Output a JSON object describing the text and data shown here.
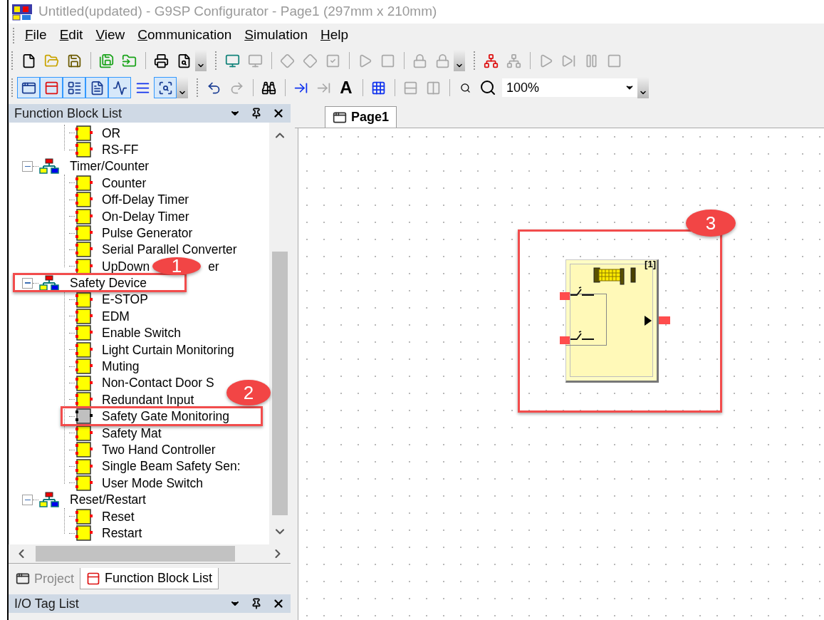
{
  "window": {
    "title": "Untitled(updated) - G9SP Configurator - Page1 (297mm x 210mm)"
  },
  "menu": [
    {
      "label": "File"
    },
    {
      "label": "Edit"
    },
    {
      "label": "View"
    },
    {
      "label": "Communication"
    },
    {
      "label": "Simulation"
    },
    {
      "label": "Help"
    }
  ],
  "toolbars": [
    {
      "sections": [
        {
          "buttons": [
            {
              "kind": "new",
              "disabled": false
            },
            {
              "kind": "open",
              "disabled": false
            },
            {
              "kind": "save",
              "disabled": false
            }
          ]
        },
        {
          "buttons": [
            {
              "kind": "save-as",
              "disabled": false
            },
            {
              "kind": "open-alt",
              "disabled": false
            }
          ]
        },
        {
          "buttons": [
            {
              "kind": "print",
              "disabled": false
            },
            {
              "kind": "preview",
              "disabled": false
            },
            {
              "kind": "overflow"
            }
          ]
        },
        {
          "buttons": [
            {
              "kind": "monitor",
              "disabled": false
            },
            {
              "kind": "monitor",
              "disabled": true
            }
          ]
        },
        {
          "buttons": [
            {
              "kind": "diamond",
              "disabled": true
            },
            {
              "kind": "diamond",
              "disabled": true
            },
            {
              "kind": "check",
              "disabled": true
            }
          ]
        },
        {
          "buttons": [
            {
              "kind": "play",
              "disabled": true
            },
            {
              "kind": "stop",
              "disabled": true
            }
          ]
        },
        {
          "buttons": [
            {
              "kind": "lock",
              "disabled": true
            },
            {
              "kind": "lock",
              "disabled": true
            },
            {
              "kind": "overflow"
            }
          ]
        },
        {
          "buttons": [
            {
              "kind": "network",
              "disabled": false
            },
            {
              "kind": "network",
              "disabled": true
            }
          ]
        },
        {
          "buttons": [
            {
              "kind": "play",
              "disabled": true
            },
            {
              "kind": "step",
              "disabled": true
            },
            {
              "kind": "pause",
              "disabled": true
            },
            {
              "kind": "stop",
              "disabled": true
            }
          ]
        }
      ]
    },
    {
      "sections": [
        {
          "buttons": [
            {
              "kind": "view-project",
              "disabled": false,
              "selected": true
            },
            {
              "kind": "view-blocks",
              "disabled": false,
              "selected": true
            },
            {
              "kind": "view-tags",
              "disabled": false,
              "selected": true
            },
            {
              "kind": "view-output",
              "disabled": false,
              "selected": true
            },
            {
              "kind": "view-monitor",
              "disabled": false,
              "selected": true
            },
            {
              "kind": "view-list",
              "disabled": false,
              "selected": false
            },
            {
              "kind": "view-search",
              "disabled": false,
              "selected": true
            },
            {
              "kind": "overflow"
            }
          ]
        },
        {
          "buttons": [
            {
              "kind": "undo",
              "disabled": false
            },
            {
              "kind": "redo",
              "disabled": true
            }
          ]
        },
        {
          "buttons": [
            {
              "kind": "find",
              "disabled": false
            }
          ]
        },
        {
          "buttons": [
            {
              "kind": "connect",
              "disabled": false
            },
            {
              "kind": "connect",
              "disabled": true
            },
            {
              "kind": "text",
              "label": "A",
              "disabled": false
            }
          ]
        },
        {
          "buttons": [
            {
              "kind": "grid",
              "disabled": false
            }
          ]
        },
        {
          "buttons": [
            {
              "kind": "rows",
              "disabled": true
            },
            {
              "kind": "columns",
              "disabled": true
            }
          ]
        },
        {
          "buttons": [
            {
              "kind": "zoom-out",
              "disabled": false
            },
            {
              "kind": "zoom-in",
              "disabled": false
            },
            {
              "kind": "zoom-combo",
              "value": "100%",
              "disabled": false
            },
            {
              "kind": "overflow"
            }
          ]
        }
      ]
    }
  ],
  "function_block_panel": {
    "title": "Function Block List",
    "tree": [
      {
        "kind": "continued",
        "children": [
          {
            "label": "OR",
            "selected": false
          },
          {
            "label": "RS-FF",
            "selected": false
          }
        ]
      },
      {
        "kind": "group",
        "label": "Timer/Counter",
        "expanded": true,
        "children": [
          {
            "label": "Counter",
            "selected": false
          },
          {
            "label": "Off-Delay Timer",
            "selected": false
          },
          {
            "label": "On-Delay Timer",
            "selected": false
          },
          {
            "label": "Pulse Generator",
            "selected": false
          },
          {
            "label": "Serial Parallel Converter",
            "selected": false
          },
          {
            "label": "UpDown",
            "label_end": "er",
            "selected": false
          }
        ]
      },
      {
        "kind": "group",
        "label": "Safety Device",
        "expanded": true,
        "children": [
          {
            "label": "E-STOP",
            "selected": false
          },
          {
            "label": "EDM",
            "selected": false
          },
          {
            "label": "Enable Switch",
            "selected": false
          },
          {
            "label": "Light Curtain Monitoring",
            "selected": false
          },
          {
            "label": "Muting",
            "selected": false
          },
          {
            "label": "Non-Contact Door S",
            "selected": false
          },
          {
            "label": "Redundant Input",
            "selected": false
          },
          {
            "label": "Safety Gate Monitoring",
            "selected": true
          },
          {
            "label": "Safety Mat",
            "selected": false
          },
          {
            "label": "Two Hand Controller",
            "selected": false
          },
          {
            "label": "Single Beam Safety Sen:",
            "selected": false
          },
          {
            "label": "User Mode Switch",
            "selected": false
          }
        ]
      },
      {
        "kind": "group",
        "label": "Reset/Restart",
        "expanded": true,
        "children": [
          {
            "label": "Reset",
            "selected": false
          },
          {
            "label": "Restart",
            "selected": false
          }
        ]
      }
    ],
    "tabs": [
      {
        "label": "Project",
        "selected": false
      },
      {
        "label": "Function Block List",
        "selected": true
      }
    ]
  },
  "io_tag_panel": {
    "title": "I/O Tag List"
  },
  "editor": {
    "tabs": [
      {
        "label": "Page1",
        "selected": true
      }
    ],
    "blocks": [
      {
        "label": "[1]"
      }
    ]
  },
  "annotations": [
    {
      "number": "1"
    },
    {
      "number": "2"
    },
    {
      "number": "3"
    }
  ]
}
